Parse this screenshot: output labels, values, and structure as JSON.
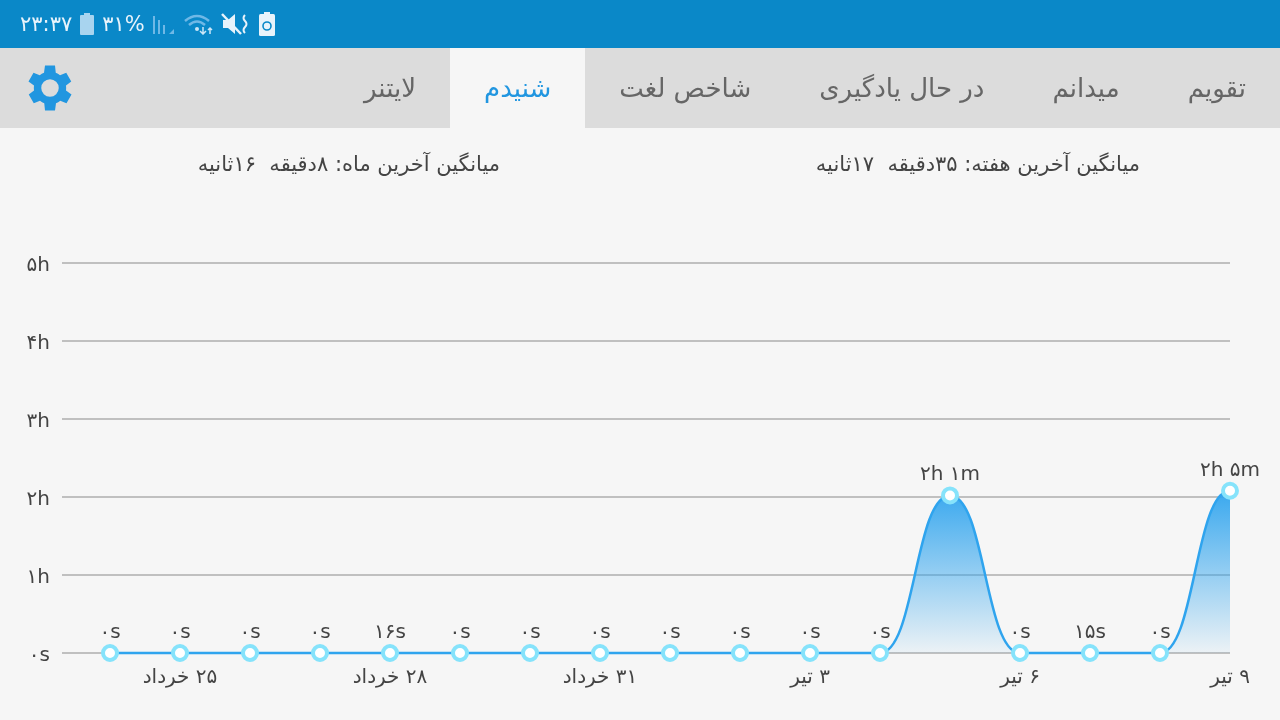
{
  "status_bar": {
    "time": "۲۳:۳۷",
    "battery_percent": "۳۱%"
  },
  "tabs": [
    {
      "label": "تقویم",
      "selected": false
    },
    {
      "label": "میدانم",
      "selected": false
    },
    {
      "label": "در حال یادگیری",
      "selected": false
    },
    {
      "label": "شاخص لغت",
      "selected": false
    },
    {
      "label": "شنیدم",
      "selected": true
    },
    {
      "label": "لایتنر",
      "selected": false
    }
  ],
  "stats": [
    "میانگین آخرین هفته: ۳۵دقیقه  ۱۷ثانیه",
    "میانگین آخرین ماه: ۸دقیقه  ۱۶ثانیه"
  ],
  "chart_data": {
    "type": "area",
    "categories": [
      null,
      "۲۵ خرداد",
      null,
      null,
      "۲۸ خرداد",
      null,
      null,
      "۳۱ خرداد",
      null,
      null,
      "۳ تیر",
      null,
      null,
      "۶ تیر",
      null,
      null,
      "۹ تیر"
    ],
    "series": [
      {
        "color": "#2fa4ee",
        "values": [
          0,
          0,
          0,
          0,
          0,
          0,
          0,
          0,
          0,
          0,
          0,
          0,
          2.02,
          0,
          0,
          0,
          2.08
        ]
      }
    ],
    "ylim": [
      0,
      5
    ],
    "grid": true,
    "yticks": [
      {
        "value": 0,
        "label": "۰s"
      },
      {
        "value": 1,
        "label": "۱h"
      },
      {
        "value": 2,
        "label": "۲h"
      },
      {
        "value": 3,
        "label": "۳h"
      },
      {
        "value": 4,
        "label": "۴h"
      },
      {
        "value": 5,
        "label": "۵h"
      }
    ],
    "value_labels": [
      "۰s",
      "۰s",
      "۰s",
      "۰s",
      "۱۶s",
      "۰s",
      "۰s",
      "۰s",
      "۰s",
      "۰s",
      "۰s",
      "۰s",
      "۲h ۱m",
      "۰s",
      "۱۵s",
      "۰s",
      "۲h ۵m"
    ]
  }
}
